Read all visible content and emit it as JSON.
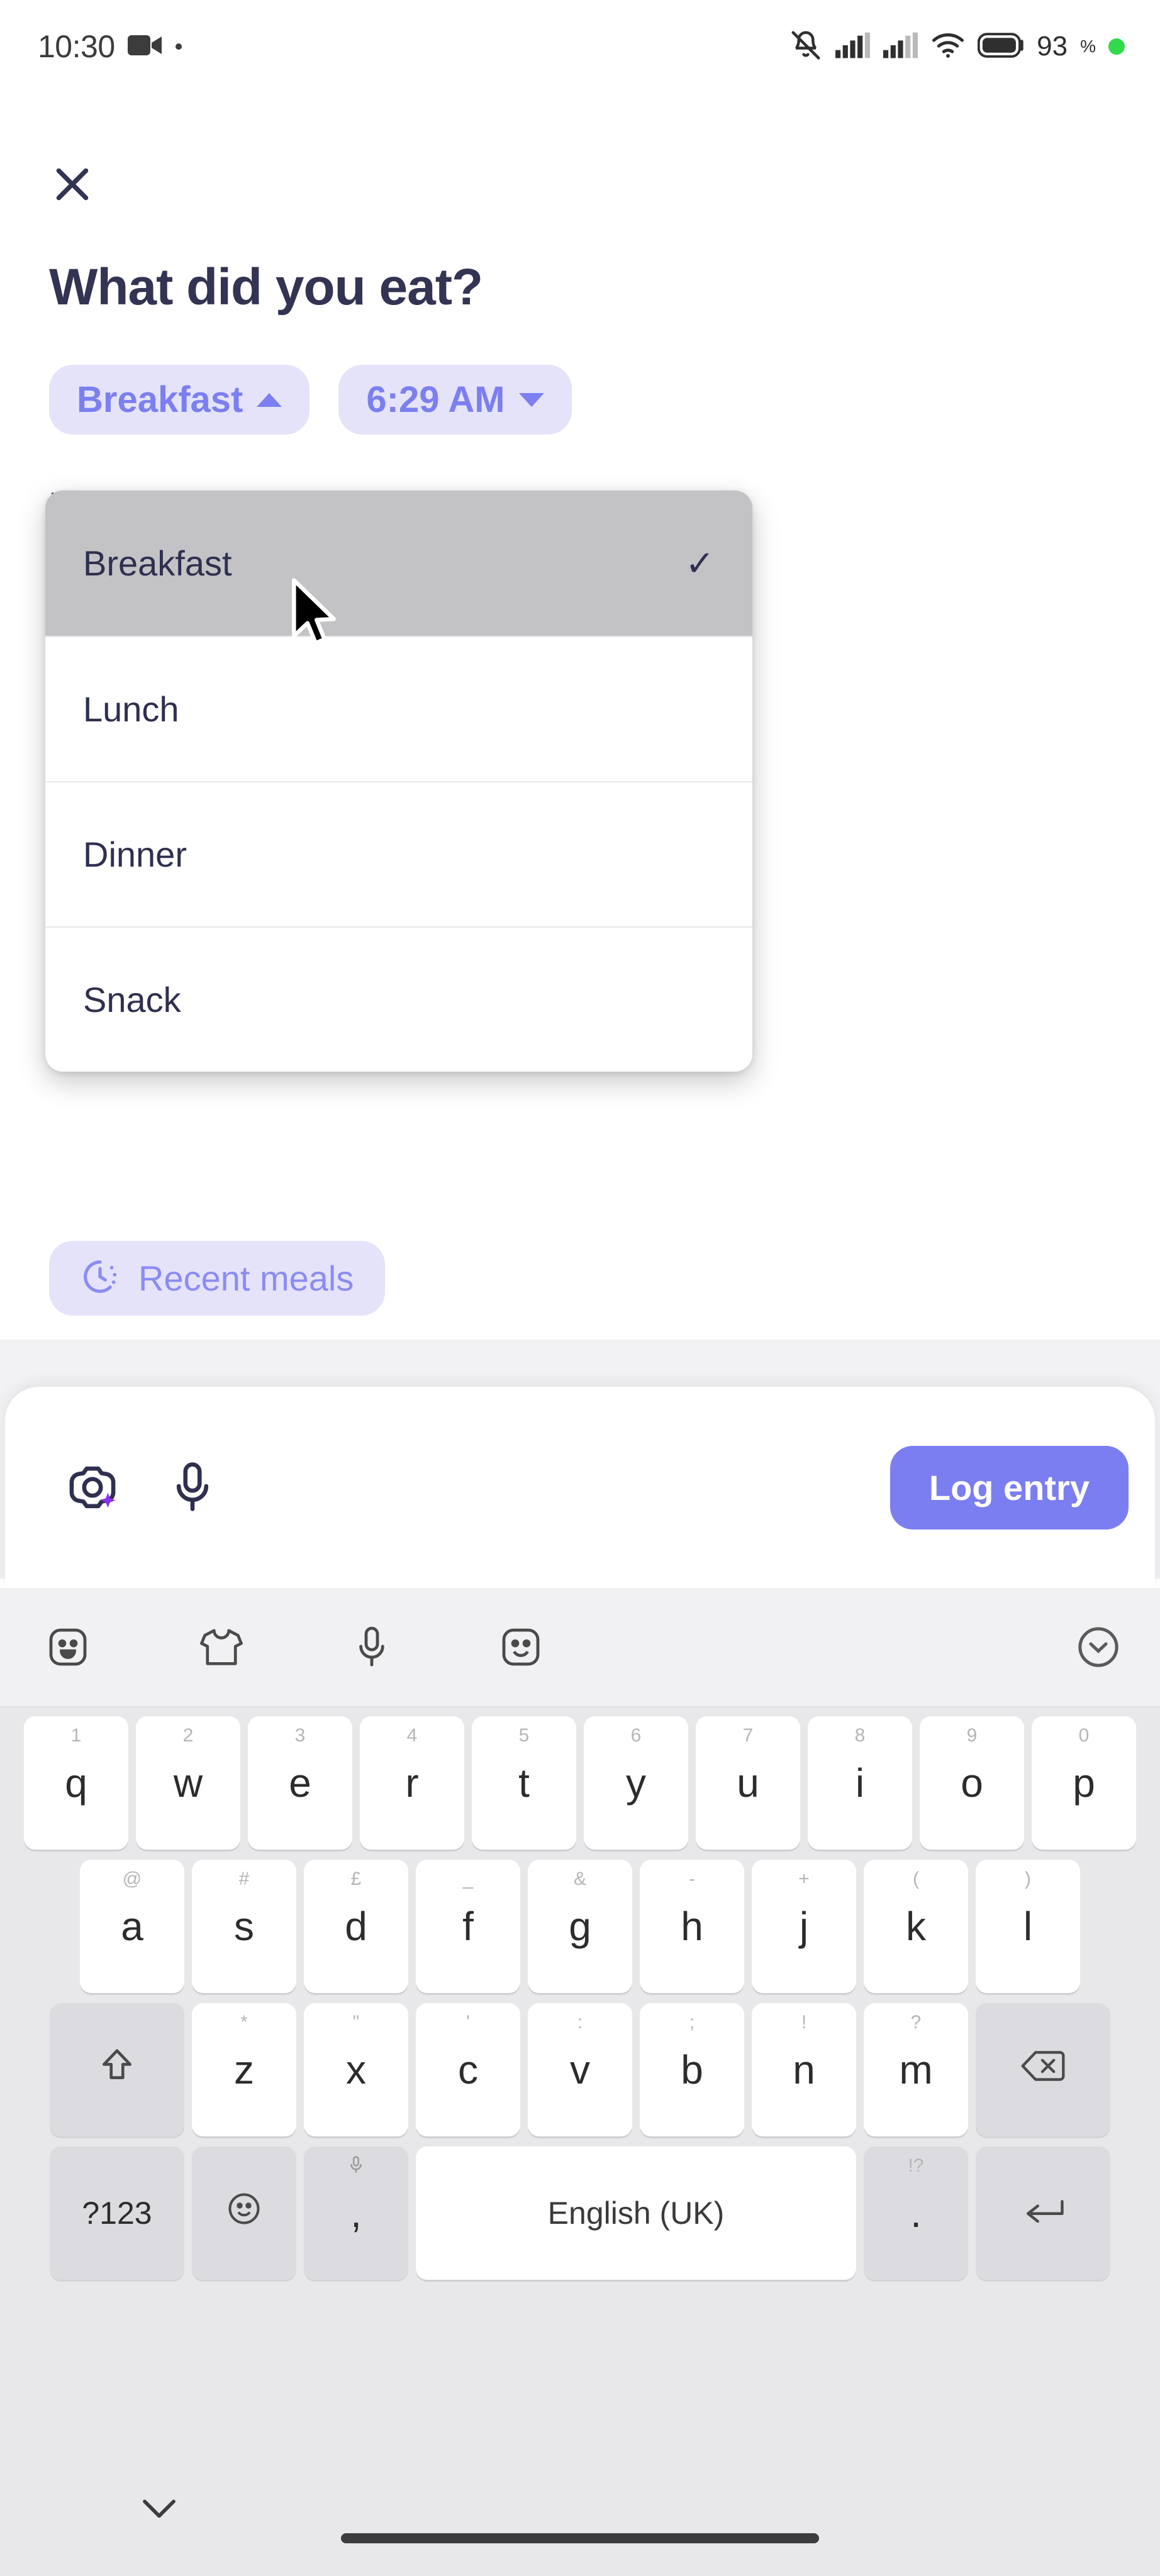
{
  "status_bar": {
    "time": "10:30",
    "recording_icon": "video-camera-icon",
    "live_dot": "recording-dot",
    "icons": [
      "bell-off-icon",
      "signal-bars-icon",
      "signal-bars-icon",
      "wifi-icon",
      "battery-icon"
    ],
    "battery_level": "93",
    "battery_unit": "%",
    "green_indicator": "green-status-dot"
  },
  "header": {
    "close_label": "close-icon",
    "title": "What did you eat?"
  },
  "chips": {
    "meal": {
      "label": "Breakfast",
      "caret": "caret-up"
    },
    "time": {
      "label": "6:29 AM",
      "caret": "caret-down"
    }
  },
  "dropdown": {
    "behind_text": "B",
    "items": [
      {
        "label": "Breakfast",
        "selected": true,
        "check": "✓"
      },
      {
        "label": "Lunch",
        "selected": false,
        "check": ""
      },
      {
        "label": "Dinner",
        "selected": false,
        "check": ""
      },
      {
        "label": "Snack",
        "selected": false,
        "check": ""
      }
    ]
  },
  "recent_meals": {
    "icon": "history-clock-icon",
    "label": "Recent meals"
  },
  "input_bar": {
    "camera_icon": "camera-ai-scan-icon",
    "mic_icon": "microphone-icon",
    "submit_label": "Log entry"
  },
  "keyboard": {
    "toolbar_icons": [
      "sticker-face-icon",
      "tshirt-icon",
      "microphone-icon",
      "smiley-icon",
      "chevron-down-circle-icon"
    ],
    "row1": [
      {
        "key": "q",
        "hint": "1"
      },
      {
        "key": "w",
        "hint": "2"
      },
      {
        "key": "e",
        "hint": "3"
      },
      {
        "key": "r",
        "hint": "4"
      },
      {
        "key": "t",
        "hint": "5"
      },
      {
        "key": "y",
        "hint": "6"
      },
      {
        "key": "u",
        "hint": "7"
      },
      {
        "key": "i",
        "hint": "8"
      },
      {
        "key": "o",
        "hint": "9"
      },
      {
        "key": "p",
        "hint": "0"
      }
    ],
    "row2": [
      {
        "key": "a",
        "hint": "@"
      },
      {
        "key": "s",
        "hint": "#"
      },
      {
        "key": "d",
        "hint": "£"
      },
      {
        "key": "f",
        "hint": "_"
      },
      {
        "key": "g",
        "hint": "&"
      },
      {
        "key": "h",
        "hint": "-"
      },
      {
        "key": "j",
        "hint": "+"
      },
      {
        "key": "k",
        "hint": "("
      },
      {
        "key": "l",
        "hint": ")"
      }
    ],
    "row3": [
      {
        "key": "z",
        "hint": "*"
      },
      {
        "key": "x",
        "hint": "\""
      },
      {
        "key": "c",
        "hint": "'"
      },
      {
        "key": "v",
        "hint": ":"
      },
      {
        "key": "b",
        "hint": ";"
      },
      {
        "key": "n",
        "hint": "!"
      },
      {
        "key": "m",
        "hint": "?"
      }
    ],
    "shift_key": "shift-arrow-icon",
    "backspace_key": "backspace-icon",
    "symbols_key": "?123",
    "emoji_key": "smiley-icon",
    "comma_key": ",",
    "comma_hint": "microphone-icon",
    "space_key": "English (UK)",
    "period_key": ".",
    "period_hint": "!?",
    "enter_key": "enter-icon"
  },
  "nav_bar": {
    "hide_keyboard": "chevron-down-icon",
    "home_indicator": "home-pill"
  },
  "colors": {
    "accent_purple": "#7b7ef0",
    "chip_bg": "#e4e3fa",
    "chip_text": "#7b7ff0",
    "heading": "#333453",
    "keyboard_bg": "#e8e8ea",
    "selected_row": "#c3c3c6",
    "green_dot": "#33d94c"
  }
}
